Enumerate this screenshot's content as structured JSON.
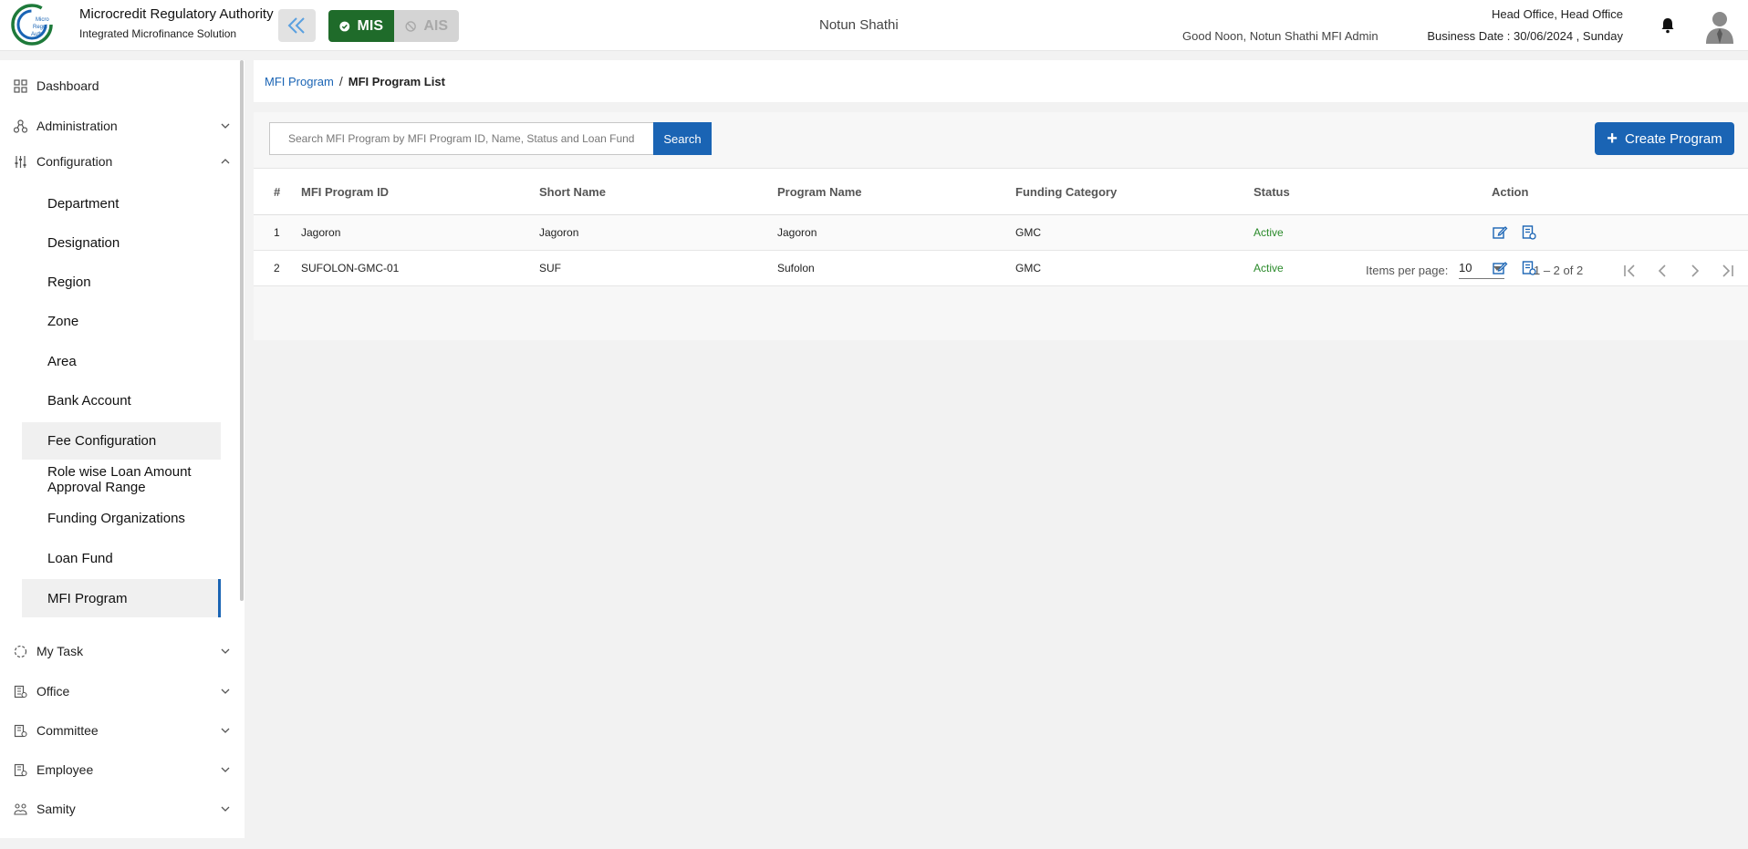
{
  "header": {
    "logo_text": "Microcredit Regulatory Authority",
    "app_title": "Microcredit Regulatory Authority",
    "app_subtitle": "Integrated Microfinance Solution",
    "mode_mis": "MIS",
    "mode_ais": "AIS",
    "center_title": "Notun Shathi",
    "greeting": "Good Noon, Notun Shathi MFI Admin",
    "office": "Head Office, Head Office",
    "business_date": "Business Date : 30/06/2024 , Sunday",
    "mis_color": "#1f6b2a",
    "accent_color": "#1a64b4"
  },
  "sidebar": {
    "top_items": [
      {
        "label": "Dashboard",
        "icon": "grid-icon"
      },
      {
        "label": "Administration",
        "icon": "hierarchy-icon"
      },
      {
        "label": "Configuration",
        "icon": "sliders-icon"
      }
    ],
    "config_items": [
      {
        "label": "Department"
      },
      {
        "label": "Designation"
      },
      {
        "label": "Region"
      },
      {
        "label": "Zone"
      },
      {
        "label": "Area"
      },
      {
        "label": "Bank Account"
      },
      {
        "label": "Fee Configuration"
      },
      {
        "label": "Role wise Loan Amount Approval Range"
      },
      {
        "label": "Funding Organizations"
      },
      {
        "label": "Loan Fund"
      },
      {
        "label": "MFI Program"
      }
    ],
    "bottom_items": [
      {
        "label": "My Task",
        "icon": "task-icon"
      },
      {
        "label": "Office",
        "icon": "office-icon"
      },
      {
        "label": "Committee",
        "icon": "committee-icon"
      },
      {
        "label": "Employee",
        "icon": "employee-icon"
      },
      {
        "label": "Samity",
        "icon": "samity-icon"
      }
    ]
  },
  "breadcrumb": {
    "link": "MFI Program",
    "separator": "/",
    "current": "MFI Program List"
  },
  "toolbar": {
    "search_placeholder": "Search MFI Program by MFI Program ID, Name, Status and Loan Fund ID",
    "search_label": "Search",
    "create_label": "Create Program"
  },
  "table": {
    "columns": [
      "#",
      "MFI Program ID",
      "Short Name",
      "Program Name",
      "Funding Category",
      "Status",
      "Action"
    ],
    "rows": [
      {
        "no": "1",
        "id": "Jagoron",
        "short": "Jagoron",
        "name": "Jagoron",
        "category": "GMC",
        "status": "Active"
      },
      {
        "no": "2",
        "id": "SUFOLON-GMC-01",
        "short": "SUF",
        "name": "Sufolon",
        "category": "GMC",
        "status": "Active"
      }
    ]
  },
  "paginator": {
    "items_label": "Items per page:",
    "page_size": "10",
    "range": "1 – 2 of 2"
  }
}
